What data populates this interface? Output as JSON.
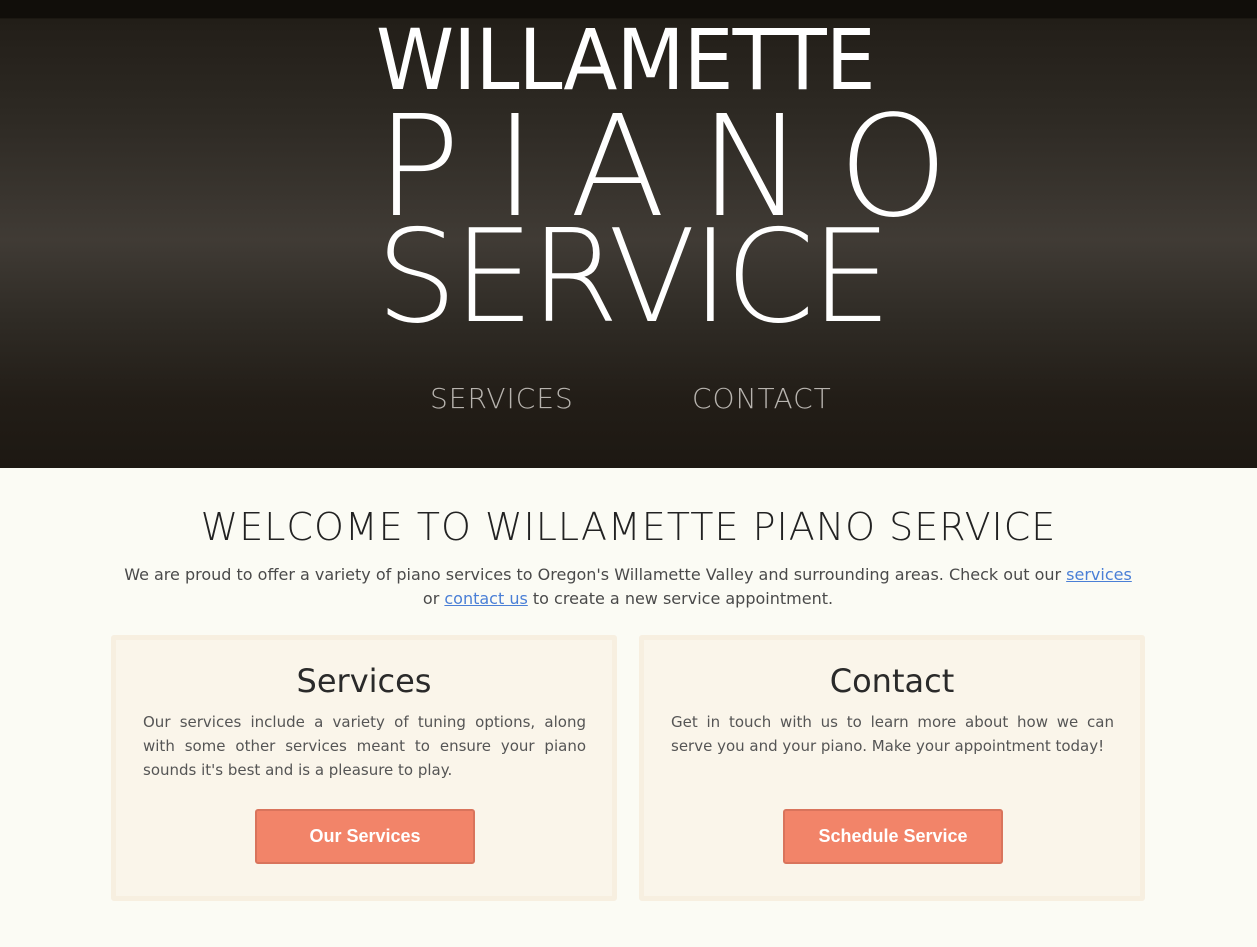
{
  "logo": {
    "line1": "WILLAMETTE",
    "line2": "PIANO",
    "line3": "SERVICE"
  },
  "nav": {
    "services": "SERVICES",
    "contact": "CONTACT"
  },
  "welcome": {
    "title": "WELCOME TO WILLAMETTE PIANO SERVICE",
    "intro_before": "We are proud to offer a variety of piano services to Oregon's Willamette Valley and surrounding areas. Check out our ",
    "services_link": "services",
    "intro_middle": " or ",
    "contact_link": "contact us",
    "intro_after": " to create a new service appointment."
  },
  "cards": {
    "services": {
      "title": "Services",
      "text": "Our services include a variety of tuning options, along with some other services meant to ensure your piano sounds it's best and is a pleasure to play.",
      "button": "Our Services"
    },
    "contact": {
      "title": "Contact",
      "text": "Get in touch with us to learn more about how we can serve you and your piano. Make your appointment today!",
      "button": "Schedule Service"
    }
  },
  "colors": {
    "accent": "#f28469",
    "link": "#4a7fd6",
    "background": "#fbfbf4",
    "card": "#faf5ea"
  }
}
